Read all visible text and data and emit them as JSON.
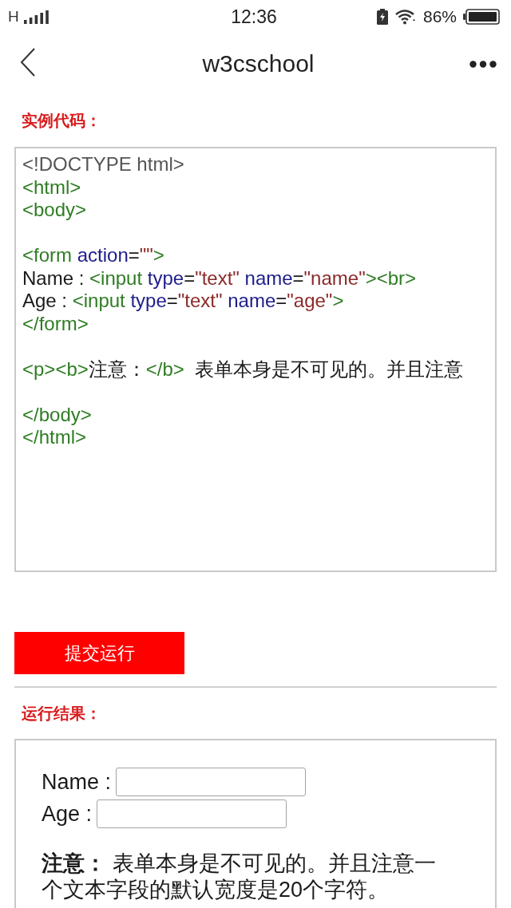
{
  "status_bar": {
    "network": "H",
    "time": "12:36",
    "battery": "86%"
  },
  "nav": {
    "title": "w3cschool"
  },
  "code_section": {
    "heading": "实例代码：",
    "lines": [
      {
        "kind": "code",
        "tokens": [
          {
            "kind": "doctype",
            "text": "<!DOCTYPE html>"
          }
        ]
      },
      {
        "kind": "code",
        "tokens": [
          {
            "kind": "tag",
            "text": "<html>"
          }
        ]
      },
      {
        "kind": "code",
        "tokens": [
          {
            "kind": "tag",
            "text": "<body>"
          }
        ]
      },
      {
        "kind": "blank"
      },
      {
        "kind": "code",
        "tokens": [
          {
            "kind": "tag",
            "text": "<form"
          },
          {
            "kind": "attr",
            "text": " action"
          },
          {
            "kind": "plain",
            "text": "="
          },
          {
            "kind": "value",
            "text": "\"\""
          },
          {
            "kind": "tag",
            "text": ">"
          }
        ]
      },
      {
        "kind": "code",
        "tokens": [
          {
            "kind": "plain",
            "text": "Name : "
          },
          {
            "kind": "tag",
            "text": "<input"
          },
          {
            "kind": "attr",
            "text": " type"
          },
          {
            "kind": "plain",
            "text": "="
          },
          {
            "kind": "value",
            "text": "\"text\""
          },
          {
            "kind": "attr",
            "text": " name"
          },
          {
            "kind": "plain",
            "text": "="
          },
          {
            "kind": "value",
            "text": "\"name\""
          },
          {
            "kind": "tag",
            "text": "><br>"
          }
        ]
      },
      {
        "kind": "code",
        "tokens": [
          {
            "kind": "plain",
            "text": "Age : "
          },
          {
            "kind": "tag",
            "text": "<input"
          },
          {
            "kind": "attr",
            "text": " type"
          },
          {
            "kind": "plain",
            "text": "="
          },
          {
            "kind": "value",
            "text": "\"text\""
          },
          {
            "kind": "attr",
            "text": " name"
          },
          {
            "kind": "plain",
            "text": "="
          },
          {
            "kind": "value",
            "text": "\"age\""
          },
          {
            "kind": "tag",
            "text": ">"
          }
        ]
      },
      {
        "kind": "code",
        "tokens": [
          {
            "kind": "tag",
            "text": "</form>"
          }
        ]
      },
      {
        "kind": "blank"
      },
      {
        "kind": "code",
        "tokens": [
          {
            "kind": "tag",
            "text": "<p><b>"
          },
          {
            "kind": "plain",
            "text": "注意："
          },
          {
            "kind": "tag",
            "text": "</b>"
          },
          {
            "kind": "plain",
            "text": "  表单本身是不可见的。并且注意"
          }
        ]
      },
      {
        "kind": "blank"
      },
      {
        "kind": "code",
        "tokens": [
          {
            "kind": "tag",
            "text": "</body>"
          }
        ]
      },
      {
        "kind": "code",
        "tokens": [
          {
            "kind": "tag",
            "text": "</html>"
          }
        ]
      }
    ]
  },
  "run_button": {
    "label": "提交运行"
  },
  "result_section": {
    "heading": "运行结果：",
    "fields": [
      {
        "label": "Name :"
      },
      {
        "label": "Age :"
      }
    ],
    "note": "**注意：** 表单本身是不可见的。并且注意一个文本字段的默认宽度是20个字符。"
  }
}
